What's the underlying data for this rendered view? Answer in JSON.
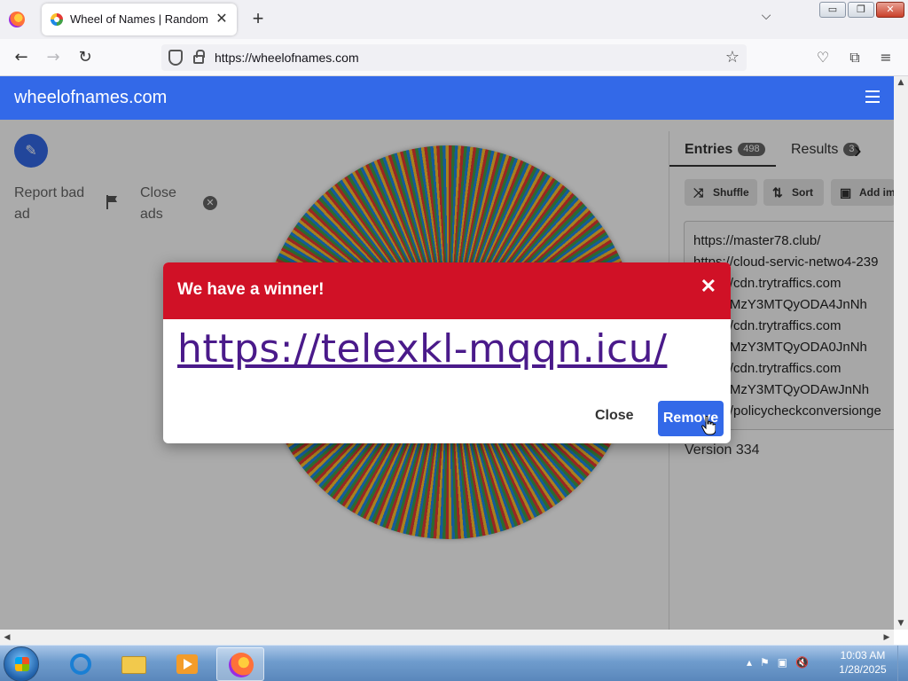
{
  "browser": {
    "tab_title": "Wheel of Names | Random name picker",
    "tab_close": "✕",
    "new_tab": "+",
    "tablist": "⌵",
    "url": "https://wheelofnames.com",
    "nav": {
      "back": "←",
      "forward": "→",
      "reload": "↻",
      "star": "☆",
      "pocket": "♡",
      "extensions": "⧉",
      "menu": "≡"
    },
    "window_buttons": {
      "minimize": "▭",
      "restore": "❐",
      "close": "✕"
    }
  },
  "site": {
    "title": "wheelofnames.com",
    "report_ad": "Report bad ad",
    "close_ads": "Close ads",
    "close_ads_icon": "✕",
    "edit_icon": "✎"
  },
  "panel": {
    "tabs": [
      {
        "label": "Entries",
        "count": "498"
      },
      {
        "label": "Results",
        "count": "3"
      }
    ],
    "next_icon": "›",
    "toolbar": [
      {
        "label": "Shuffle",
        "icon": "⤨"
      },
      {
        "label": "Sort",
        "icon": "⇅"
      },
      {
        "label": "Add image",
        "icon": "▣"
      }
    ],
    "entries": [
      "https://master78.club/",
      "https://cloud-servic-netwo4-239",
      "https://cdn.trytraffics.com",
      "aWE9MzY3MTQyODA4JnNh",
      "https://cdn.trytraffics.com",
      "aWE9MzY3MTQyODA0JnNh",
      "https://cdn.trytraffics.com",
      "aWE9MzY3MTQyODAwJnNh",
      "https://policycheckconversionge"
    ],
    "version": "Version 334"
  },
  "modal": {
    "title": "We have a winner!",
    "close_icon": "✕",
    "winner": "https://telexkl-mqqn.icu/",
    "close_label": "Close",
    "remove_label": "Remove"
  },
  "taskbar": {
    "time": "10:03 AM",
    "date": "1/28/2025",
    "tray": {
      "show_hidden": "▴",
      "flag": "⚑",
      "network": "▣",
      "volume": "🔇"
    }
  }
}
